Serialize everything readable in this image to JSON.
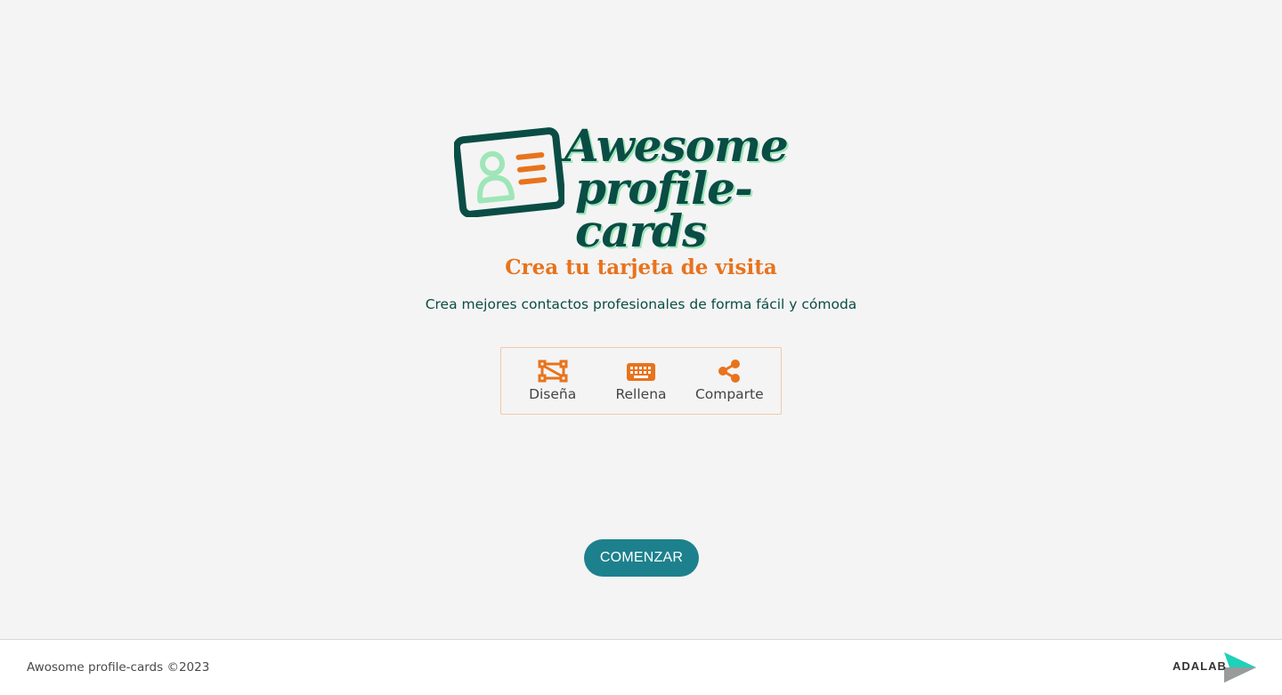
{
  "logo": {
    "line1": "Awesome",
    "line2": "profile-cards",
    "icon": "profile-card-icon"
  },
  "hero": {
    "title": "Crea tu tarjeta de visita",
    "subtitle": "Crea mejores contactos profesionales de forma fácil y cómoda"
  },
  "steps": [
    {
      "label": "Diseña",
      "icon": "design-shape-icon"
    },
    {
      "label": "Rellena",
      "icon": "keyboard-icon"
    },
    {
      "label": "Comparte",
      "icon": "share-icon"
    }
  ],
  "cta": {
    "label": "COMENZAR"
  },
  "footer": {
    "copyright": "Awosome profile-cards ©2023",
    "brand": "ADALAB",
    "brand_icon": "adalab-arrow-icon"
  },
  "colors": {
    "background": "#f4f4f4",
    "primary_dark": "#0a4d45",
    "accent_orange": "#e8731c",
    "accent_mint": "#9ee6b8",
    "button": "#1d818d",
    "adalab_teal": "#1fd1b9"
  }
}
